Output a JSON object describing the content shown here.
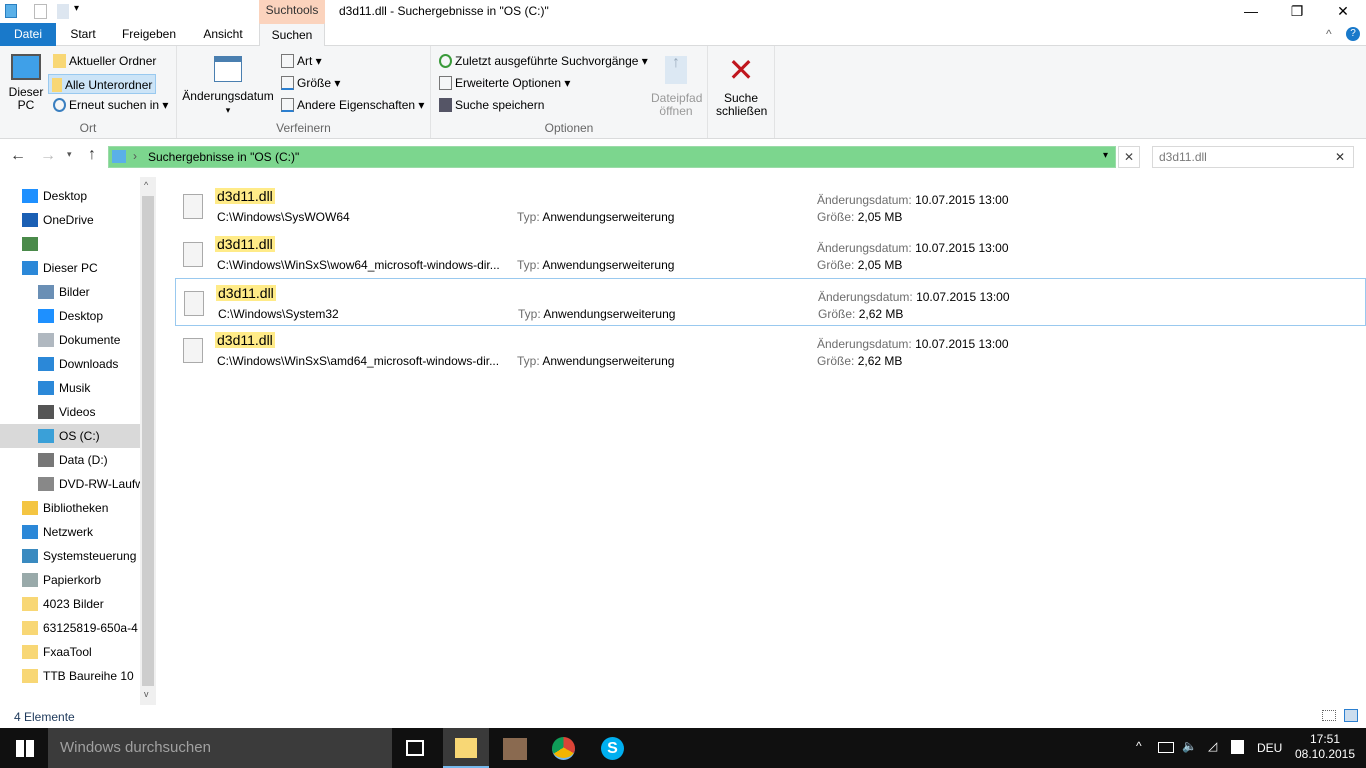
{
  "window": {
    "title": "d3d11.dll - Suchergebnisse in \"OS (C:)\"",
    "context_tab": "Suchtools",
    "minimize": "—",
    "maximize": "❐",
    "close": "✕"
  },
  "tabs": [
    {
      "label": "Datei"
    },
    {
      "label": "Start"
    },
    {
      "label": "Freigeben"
    },
    {
      "label": "Ansicht"
    },
    {
      "label": "Suchen",
      "active": true
    }
  ],
  "ribbon": {
    "ort": {
      "label": "Ort",
      "dieser_pc": "Dieser PC",
      "aktueller_ordner": "Aktueller Ordner",
      "alle_unterordner": "Alle Unterordner",
      "erneut": "Erneut suchen in ▾"
    },
    "verfeinern": {
      "label": "Verfeinern",
      "aenderungsdatum": "Änderungsdatum",
      "art": "Art ▾",
      "groesse": "Größe ▾",
      "andere": "Andere Eigenschaften ▾"
    },
    "optionen": {
      "label": "Optionen",
      "zuletzt": "Zuletzt ausgeführte Suchvorgänge ▾",
      "erweitert": "Erweiterte Optionen ▾",
      "speichern": "Suche speichern",
      "dateipfad": "Dateipfad öffnen"
    },
    "schliessen": "Suche schließen"
  },
  "address": {
    "path": "Suchergebnisse in \"OS (C:)\"",
    "search_value": "d3d11.dll"
  },
  "nav": [
    {
      "label": "Desktop",
      "indent": 0,
      "color": "#1e90ff"
    },
    {
      "label": "OneDrive",
      "indent": 0,
      "color": "#1a5fb4"
    },
    {
      "label": "",
      "indent": 0,
      "color": "#4a8a4a"
    },
    {
      "label": "Dieser PC",
      "indent": 0,
      "color": "#2b88d8"
    },
    {
      "label": "Bilder",
      "indent": 1,
      "color": "#6a8fb5"
    },
    {
      "label": "Desktop",
      "indent": 1,
      "color": "#1e90ff"
    },
    {
      "label": "Dokumente",
      "indent": 1,
      "color": "#b0b8c0"
    },
    {
      "label": "Downloads",
      "indent": 1,
      "color": "#2b88d8"
    },
    {
      "label": "Musik",
      "indent": 1,
      "color": "#2b88d8"
    },
    {
      "label": "Videos",
      "indent": 1,
      "color": "#555"
    },
    {
      "label": "OS (C:)",
      "indent": 1,
      "color": "#3aa0d8",
      "selected": true
    },
    {
      "label": "Data (D:)",
      "indent": 1,
      "color": "#777"
    },
    {
      "label": "DVD-RW-Laufwerk",
      "indent": 1,
      "color": "#888"
    },
    {
      "label": "Bibliotheken",
      "indent": 0,
      "color": "#f4c542"
    },
    {
      "label": "Netzwerk",
      "indent": 0,
      "color": "#2b88d8"
    },
    {
      "label": "Systemsteuerung",
      "indent": 0,
      "color": "#3a8ac0"
    },
    {
      "label": "Papierkorb",
      "indent": 0,
      "color": "#9aa"
    },
    {
      "label": "4023 Bilder",
      "indent": 0,
      "color": "#f8d775"
    },
    {
      "label": "63125819-650a-4",
      "indent": 0,
      "color": "#f8d775"
    },
    {
      "label": "FxaaTool",
      "indent": 0,
      "color": "#f8d775"
    },
    {
      "label": "TTB Baureihe 10",
      "indent": 0,
      "color": "#f8d775"
    }
  ],
  "results": [
    {
      "name": "d3d11.dll",
      "path": "C:\\Windows\\SysWOW64",
      "type_label": "Typ:",
      "type": "Anwendungserweiterung",
      "date_label": "Änderungsdatum:",
      "date": "10.07.2015 13:00",
      "size_label": "Größe:",
      "size": "2,05 MB"
    },
    {
      "name": "d3d11.dll",
      "path": "C:\\Windows\\WinSxS\\wow64_microsoft-windows-dir...",
      "type_label": "Typ:",
      "type": "Anwendungserweiterung",
      "date_label": "Änderungsdatum:",
      "date": "10.07.2015 13:00",
      "size_label": "Größe:",
      "size": "2,05 MB"
    },
    {
      "name": "d3d11.dll",
      "path": "C:\\Windows\\System32",
      "type_label": "Typ:",
      "type": "Anwendungserweiterung",
      "date_label": "Änderungsdatum:",
      "date": "10.07.2015 13:00",
      "size_label": "Größe:",
      "size": "2,62 MB",
      "selected": true
    },
    {
      "name": "d3d11.dll",
      "path": "C:\\Windows\\WinSxS\\amd64_microsoft-windows-dir...",
      "type_label": "Typ:",
      "type": "Anwendungserweiterung",
      "date_label": "Änderungsdatum:",
      "date": "10.07.2015 13:00",
      "size_label": "Größe:",
      "size": "2,62 MB"
    }
  ],
  "status": {
    "count": "4 Elemente"
  },
  "taskbar": {
    "search_placeholder": "Windows durchsuchen",
    "lang": "DEU",
    "time": "17:51",
    "date": "08.10.2015"
  }
}
